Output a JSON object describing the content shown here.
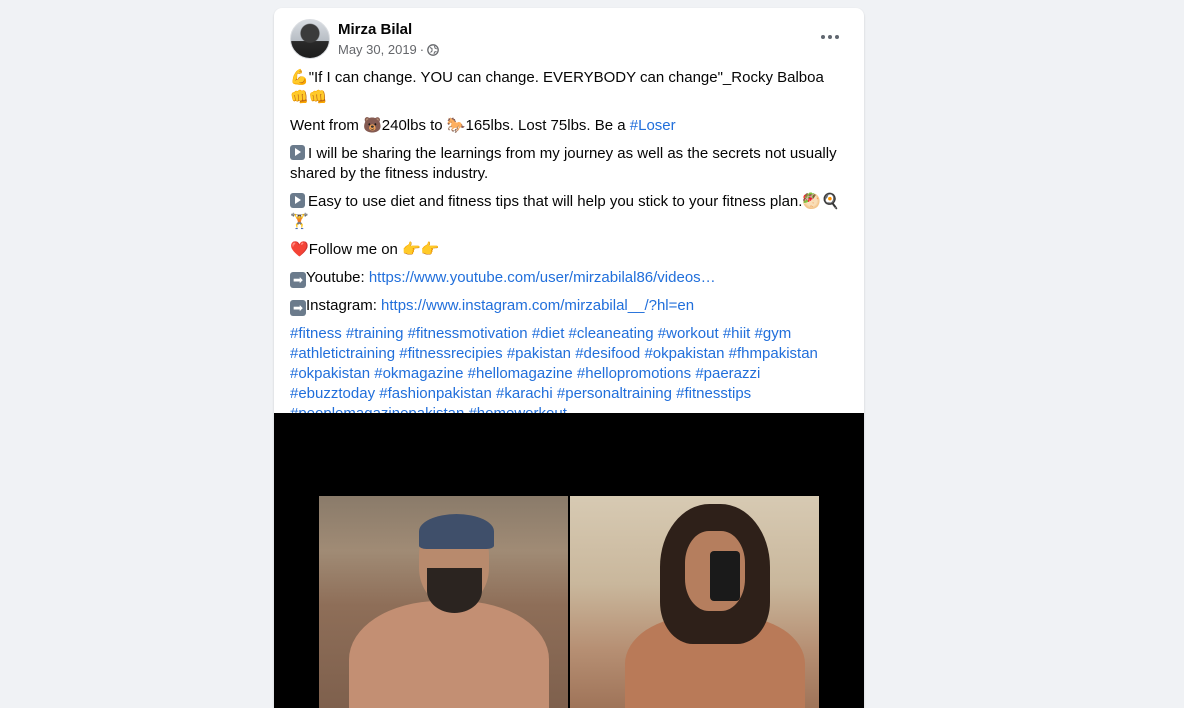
{
  "post": {
    "author": "Mirza Bilal",
    "date": "May 30, 2019",
    "date_separator": "·",
    "lines": {
      "quote": "\"If I can change. YOU can change. EVERYBODY can change\"_Rocky Balboa ",
      "went_a": "Went from ",
      "went_b": "240lbs to ",
      "went_c": "165lbs. Lost 75lbs. Be a ",
      "loser_tag": "#Loser",
      "sharing": "I will be sharing the learnings from my journey as well as the secrets not usually shared by the fitness industry.",
      "tips": "Easy to use diet and fitness tips that will help you stick to your fitness plan.",
      "follow": "Follow me on ",
      "youtube_label": "Youtube: ",
      "youtube_url": "https://www.youtube.com/user/mirzabilal86/videos…",
      "instagram_label": "Instagram: ",
      "instagram_url": "https://www.instagram.com/mirzabilal__/?hl=en"
    },
    "emojis": {
      "muscle": "💪",
      "fists": "👊👊",
      "bear": "🐻",
      "horse": "🐎",
      "food": "🥙🍳",
      "weights": "🏋",
      "heart": "❤️",
      "point": "👉👉",
      "arrow": "➡"
    },
    "hashtags": [
      "#fitness",
      "#training",
      "#fitnessmotivation",
      "#diet",
      "#cleaneating",
      "#workout",
      "#hiit",
      "#gym",
      "#athletictraining",
      "#fitnessrecipies",
      "#pakistan",
      "#desifood",
      "#okpakistan",
      "#fhmpakistan",
      "#okpakistan",
      "#okmagazine",
      "#hellomagazine",
      "#hellopromotions",
      "#paerazzi",
      "#ebuzztoday",
      "#fashionpakistan",
      "#karachi",
      "#personaltraining",
      "#fitnesstips",
      "#peoplemagazinepakistan",
      "#homeworkout"
    ]
  },
  "icons": {
    "audience": "globe-icon",
    "more": "more-options-icon",
    "play": "play-button-icon",
    "arrow": "right-arrow-icon"
  },
  "colors": {
    "link": "#216fdb",
    "background": "#f0f2f5",
    "meta_text": "#65676b"
  }
}
